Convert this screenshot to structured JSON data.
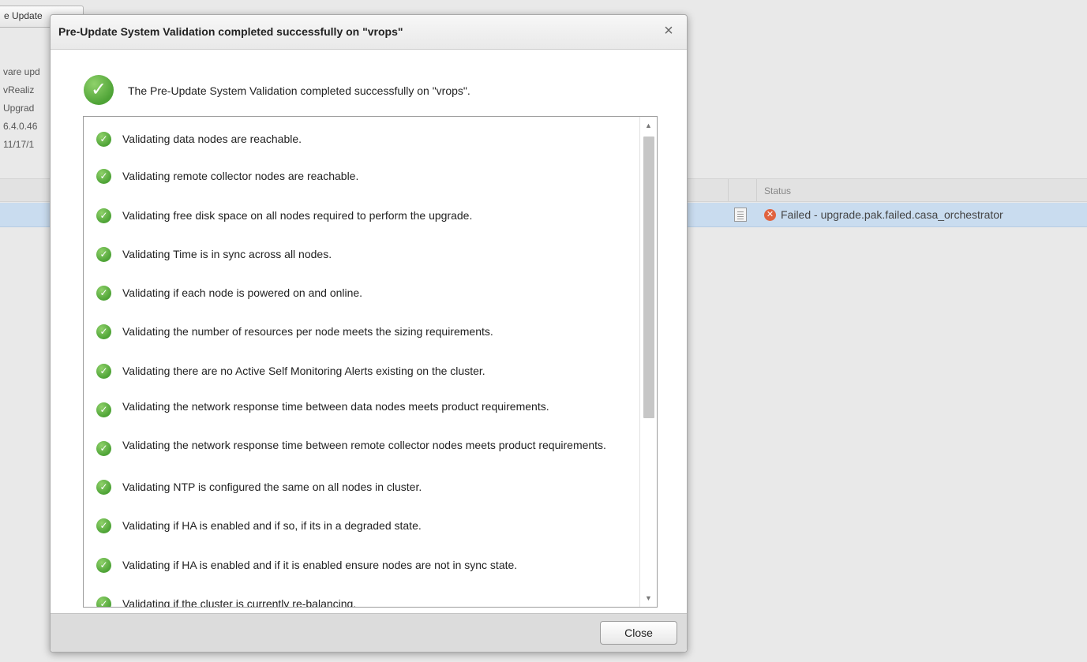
{
  "background": {
    "button_label": "e Update",
    "info_lines": [
      "vare upd",
      "vRealiz",
      "Upgrad",
      "6.4.0.46",
      "11/17/1"
    ],
    "table": {
      "status_header": "Status",
      "row": {
        "status_text": "Failed - upgrade.pak.failed.casa_orchestrator"
      }
    }
  },
  "modal": {
    "title": "Pre-Update System Validation completed successfully on \"vrops\"",
    "success_message": "The Pre-Update System Validation completed successfully on \"vrops\".",
    "items": [
      "Validating data nodes are reachable.",
      "Validating remote collector nodes are reachable.",
      "Validating free disk space on all nodes required to perform the upgrade.",
      "Validating Time is in sync across all nodes.",
      "Validating if each node is powered on and online.",
      "Validating the number of resources per node meets the sizing requirements.",
      "Validating there are no Active Self Monitoring Alerts existing on the cluster.",
      "Validating the network response time between data nodes meets product requirements.",
      "Validating the network response time between remote collector nodes meets product requirements.",
      "Validating NTP is configured the same on all nodes in cluster.",
      "Validating if HA is enabled and if so, if its in a degraded state.",
      "Validating if HA is enabled and if it is enabled ensure nodes are not in sync state.",
      "Validating if the cluster is currently re-balancing."
    ],
    "close_label": "Close",
    "close_icon": "×"
  },
  "colors": {
    "success_green": "#4ea336",
    "failure_red": "#e0623f",
    "selected_row": "#c9dcef"
  }
}
